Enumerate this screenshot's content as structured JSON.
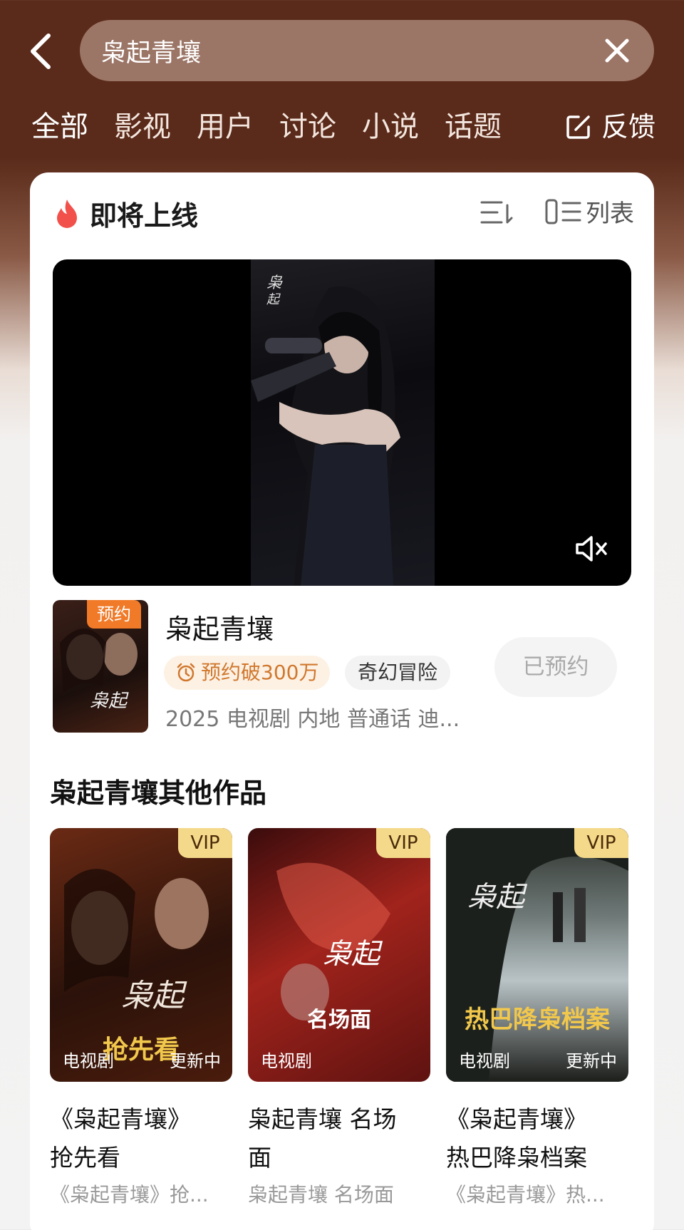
{
  "search": {
    "query": "枭起青壤"
  },
  "tabs": [
    "全部",
    "影视",
    "用户",
    "讨论",
    "小说",
    "话题"
  ],
  "feedback_label": "反馈",
  "section": {
    "title": "即将上线",
    "view_label": "列表"
  },
  "drama": {
    "title": "枭起青壤",
    "tag": "预约",
    "hot_label": "预约破300万",
    "genre": "奇幻冒险",
    "meta": "2025 电视剧 内地 普通话 迪...",
    "booked_label": "已预约"
  },
  "other": {
    "title": "枭起青壤其他作品",
    "works": [
      {
        "vip": "VIP",
        "left_tag": "电视剧",
        "right_tag": "更新中",
        "cover_text": "抢先看",
        "title_line1": "《枭起青壤》",
        "title_line2": "抢先看",
        "subtitle": "《枭起青壤》抢..."
      },
      {
        "vip": "VIP",
        "left_tag": "电视剧",
        "right_tag": "",
        "cover_text": "名场面",
        "title_line1": "枭起青壤 名场",
        "title_line2": "面",
        "subtitle": "枭起青壤 名场面"
      },
      {
        "vip": "VIP",
        "left_tag": "电视剧",
        "right_tag": "更新中",
        "cover_text": "热巴降枭档案",
        "title_line1": "《枭起青壤》",
        "title_line2": "热巴降枭档案",
        "subtitle": "《枭起青壤》热..."
      }
    ]
  },
  "colors": {
    "header_bg": "#5a2a1a",
    "accent_orange": "#f07a28",
    "vip_gold": "#f4d98a"
  }
}
